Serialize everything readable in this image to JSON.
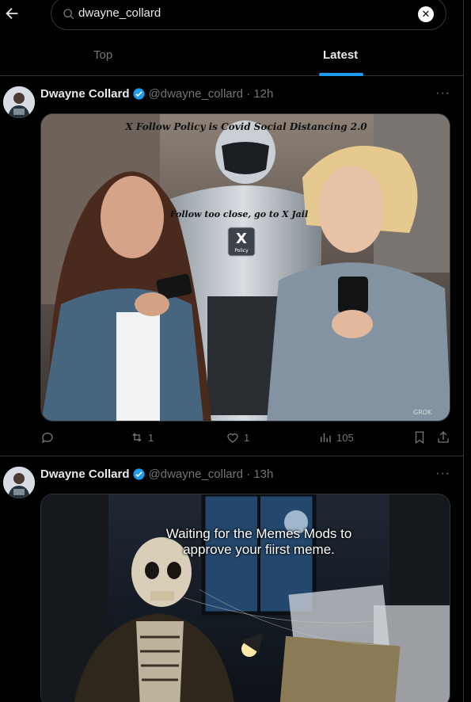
{
  "search": {
    "query": "dwayne_collard"
  },
  "tabs": [
    {
      "label": "Top"
    },
    {
      "label": "Latest"
    }
  ],
  "posts": [
    {
      "name": "Dwayne Collard",
      "handle": "@dwayne_collard",
      "time": "12h",
      "image": {
        "caption_top": "X Follow Policy is Covid Social Distancing 2.0",
        "caption_mid": "Follow too close, go to X Jail",
        "badge_letter": "X",
        "badge_text": "Policy",
        "watermark": "GROK"
      },
      "actions": {
        "replies": "",
        "reposts": "1",
        "likes": "1",
        "views": "105"
      }
    },
    {
      "name": "Dwayne Collard",
      "handle": "@dwayne_collard",
      "time": "13h",
      "image": {
        "caption": "Waiting for the Memes Mods to approve your fiirst meme."
      }
    }
  ],
  "colors": {
    "accent": "#1d9bf0",
    "muted": "#71767b",
    "divider": "#2f3336"
  }
}
